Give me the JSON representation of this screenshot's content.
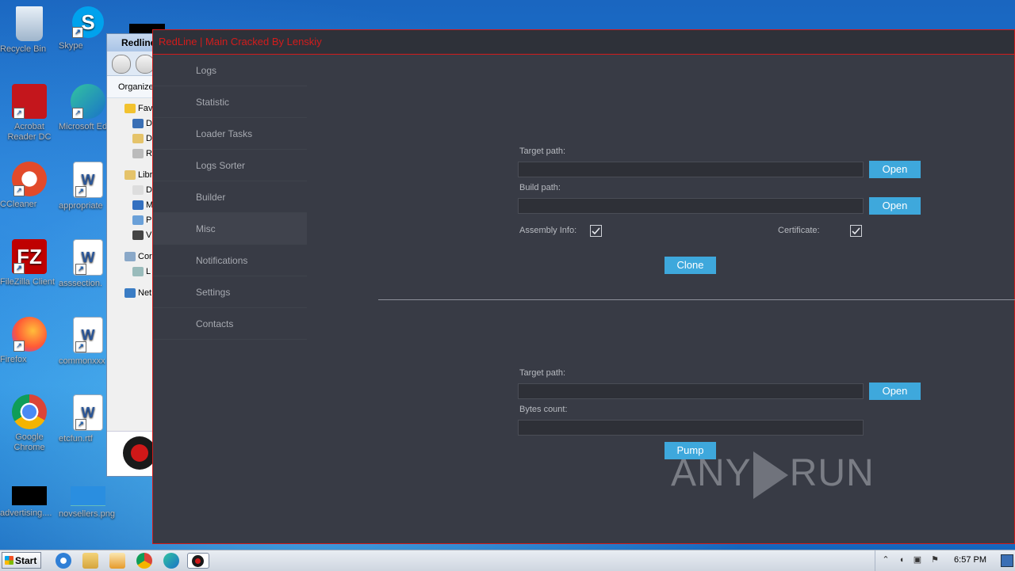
{
  "desktop": {
    "icons": [
      {
        "label": "Recycle Bin",
        "icon": "recycle-bin-icon"
      },
      {
        "label": "Skype",
        "icon": "skype-icon"
      },
      {
        "label": "Acrobat Reader DC",
        "icon": "acrobat-icon"
      },
      {
        "label": "Microsoft Ed",
        "icon": "edge-icon"
      },
      {
        "label": "CCleaner",
        "icon": "ccleaner-icon"
      },
      {
        "label": "appropriate",
        "icon": "word-doc-icon"
      },
      {
        "label": "FileZilla Client",
        "icon": "filezilla-icon"
      },
      {
        "label": "asssection.",
        "icon": "word-doc-icon"
      },
      {
        "label": "Firefox",
        "icon": "firefox-icon"
      },
      {
        "label": "commonxxx",
        "icon": "word-doc-icon"
      },
      {
        "label": "Google Chrome",
        "icon": "chrome-icon"
      },
      {
        "label": "etcfun.rtf",
        "icon": "word-doc-icon"
      },
      {
        "label": "advertising....",
        "icon": "black-file-icon"
      },
      {
        "label": "novsellers.png",
        "icon": "image-file-icon"
      }
    ]
  },
  "explorer": {
    "title": "Redline",
    "organize": "Organize",
    "tree": [
      "Fav",
      "D",
      "D",
      "R",
      "Libr",
      "D",
      "M",
      "P",
      "V",
      "Cor",
      "L",
      "Net"
    ]
  },
  "app": {
    "title": "RedLine | Main Cracked By Lenskiy",
    "sidebar": [
      "Logs",
      "Statistic",
      "Loader Tasks",
      "Logs Sorter",
      "Builder",
      "Misc",
      "Notifications",
      "Settings",
      "Contacts"
    ],
    "active_item": "Misc",
    "clone_section": {
      "target_path_label": "Target path:",
      "target_path_value": "",
      "build_path_label": "Build path:",
      "build_path_value": "",
      "open_label": "Open",
      "assembly_info_label": "Assembly Info:",
      "assembly_info_checked": true,
      "certificate_label": "Certificate:",
      "certificate_checked": true,
      "clone_label": "Clone"
    },
    "pump_section": {
      "target_path_label": "Target path:",
      "target_path_value": "",
      "open_label": "Open",
      "bytes_count_label": "Bytes count:",
      "bytes_count_value": "",
      "pump_label": "Pump"
    }
  },
  "watermark": {
    "left": "ANY",
    "right": "RUN"
  },
  "taskbar": {
    "start_label": "Start",
    "clock": "6:57 PM"
  },
  "colors": {
    "accent": "#3ea8dc",
    "title_red": "#d31c1c",
    "app_bg": "#383b45"
  }
}
